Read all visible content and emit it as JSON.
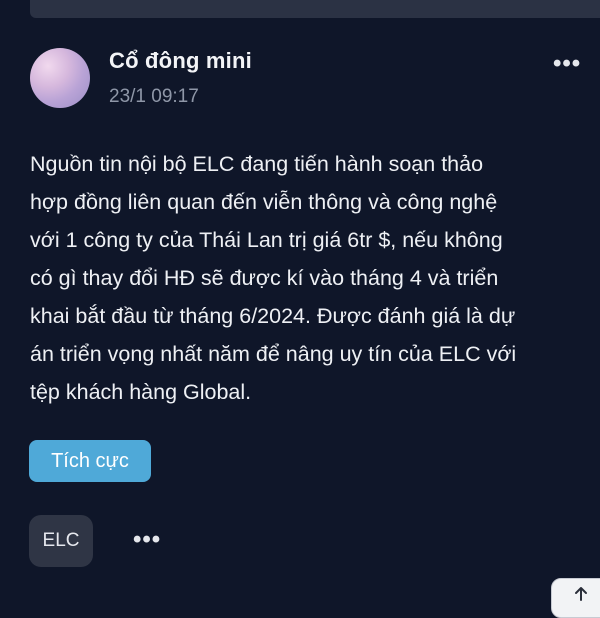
{
  "post": {
    "author": "Cổ đông mini",
    "timestamp": "23/1 09:17",
    "more_icon": "more-horizontal-icon",
    "body_lines": [
      "Nguồn tin nội bộ ELC đang tiến hành soạn thảo",
      "hợp đồng liên quan đến viễn thông và công nghệ",
      "với 1 công ty của Thái Lan trị giá 6tr $, nếu không",
      "có gì thay đổi HĐ sẽ được kí vào tháng 4 và triển",
      "khai bắt đầu từ tháng 6/2024. Được đánh giá là dự",
      "án triển vọng nhất năm để nâng uy tín của ELC với",
      "tệp khách hàng Global."
    ],
    "sentiment_label": "Tích cực",
    "ticker": "ELC"
  },
  "colors": {
    "background": "#0f1629",
    "sentiment": "#4fa9d8",
    "ticker_chip": "#2f3545"
  },
  "icons": {
    "scroll_top": "arrow-up-icon"
  }
}
